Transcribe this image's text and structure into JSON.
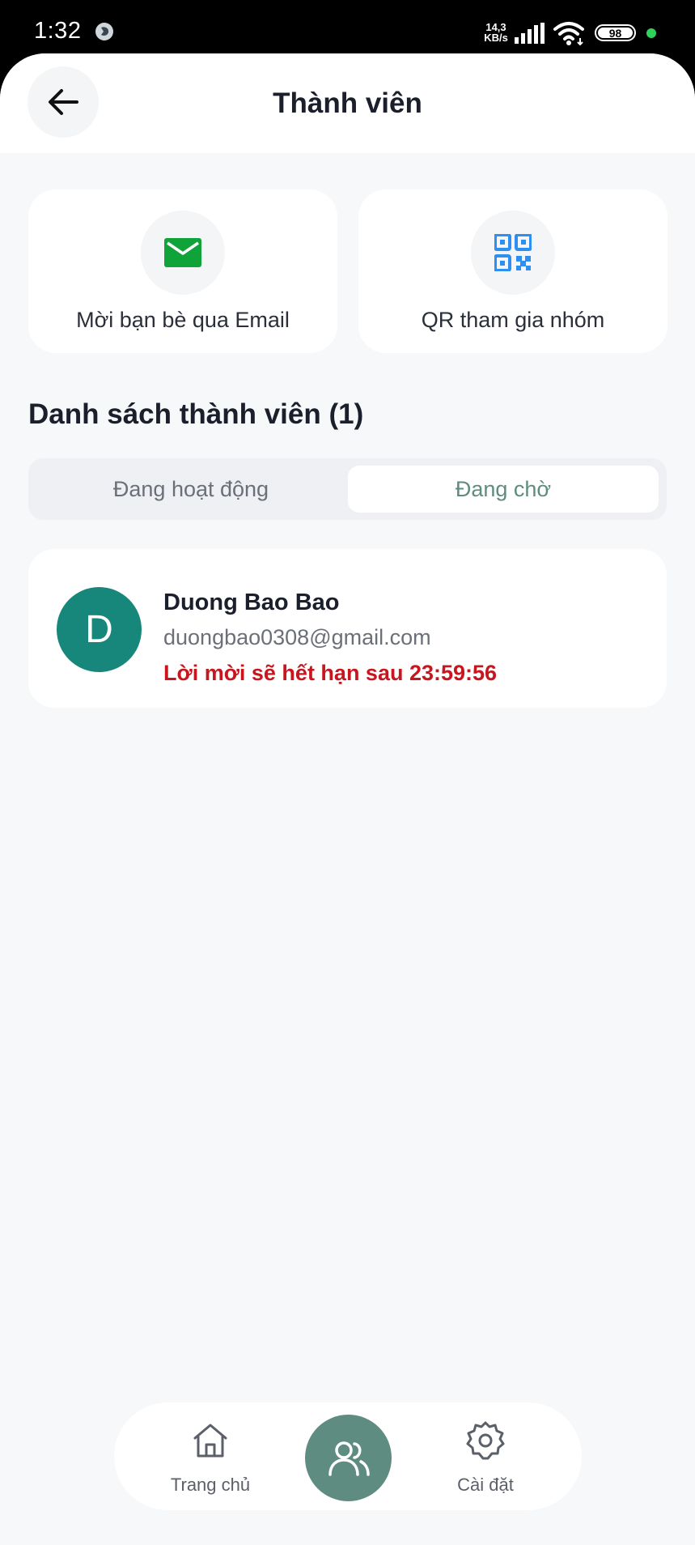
{
  "status_bar": {
    "time": "1:32",
    "net_speed_value": "14,3",
    "net_speed_unit": "KB/s",
    "battery": "98"
  },
  "header": {
    "title": "Thành viên"
  },
  "actions": {
    "email_label": "Mời bạn bè qua Email",
    "qr_label": "QR tham gia nhóm"
  },
  "members": {
    "section_title": "Danh sách thành viên (1)",
    "tabs": {
      "active": "Đang hoạt động",
      "pending": "Đang chờ"
    },
    "selected_tab": "pending",
    "items": [
      {
        "initial": "D",
        "name": "Duong Bao Bao",
        "email": "duongbao0308@gmail.com",
        "expiry": "Lời mời sẽ hết hạn sau 23:59:56"
      }
    ]
  },
  "bottom_nav": {
    "home_label": "Trang chủ",
    "settings_label": "Cài đặt",
    "center_icon": "members-icon"
  },
  "colors": {
    "accent": "#5f8c80",
    "avatar": "#17877c",
    "expiry_text": "#c8151e",
    "email_icon": "#10a33a",
    "qr_icon": "#2f8ff0"
  }
}
